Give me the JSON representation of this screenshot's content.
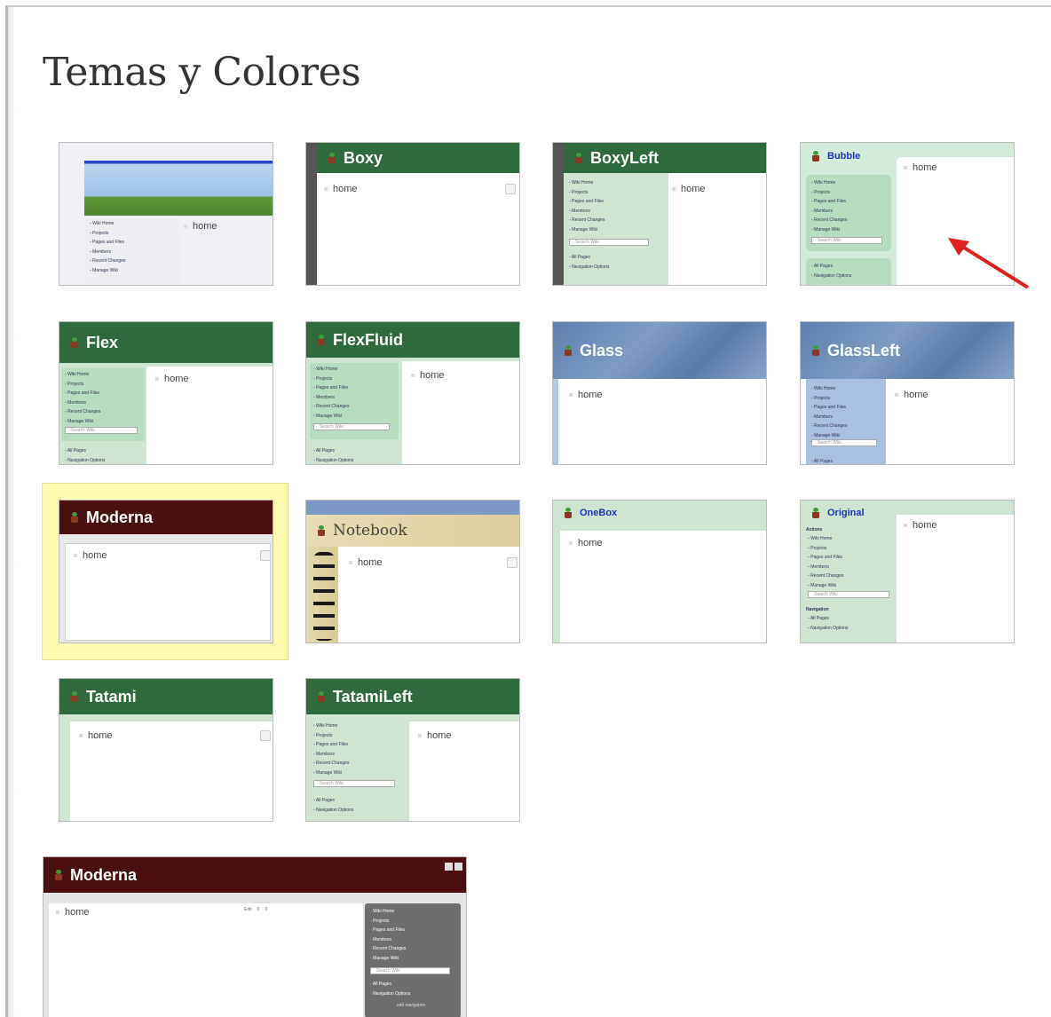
{
  "page_title": "Temas y Colores",
  "home_label": "home",
  "nav": {
    "wiki_home": "Wiki Home",
    "projects": "Projects",
    "pages_and_files": "Pages and Files",
    "members": "Members",
    "recent_changes": "Recent Changes",
    "manage_wiki": "Manage Wiki",
    "search": "Search Wiki",
    "all_pages": "All Pages",
    "navigation_options": "Navigation Options",
    "edit_navigation": "edit navigation",
    "actions": "Actions",
    "navigation": "Navigation"
  },
  "themes": {
    "t1": "",
    "boxy": "Boxy",
    "boxyleft": "BoxyLeft",
    "bubble": "Bubble",
    "flex": "Flex",
    "flexfluid": "FlexFluid",
    "glass": "Glass",
    "glassleft": "GlassLeft",
    "moderna": "Moderna",
    "notebook": "Notebook",
    "onebox": "OneBox",
    "original": "Original",
    "tatami": "Tatami",
    "tatamileft": "TatamiLeft"
  },
  "selected_theme": "Moderna",
  "preview": {
    "title": "Moderna",
    "edit_label": "Edit",
    "count_a": "0",
    "count_b": "0"
  },
  "colors": {
    "green_header": "#2f6a3f",
    "maroon_header": "#4a0f10",
    "selection_highlight": "#fffbb2",
    "arrow": "#e02020"
  }
}
